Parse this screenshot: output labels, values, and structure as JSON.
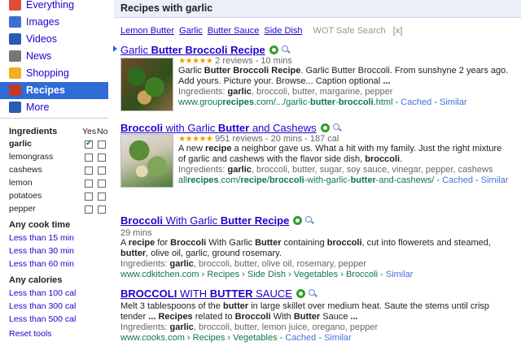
{
  "nav": {
    "items": [
      {
        "label": "Everything",
        "icon": "everything-icon",
        "color": "#e04b3a"
      },
      {
        "label": "Images",
        "icon": "images-icon",
        "color": "#3b6fd1"
      },
      {
        "label": "Videos",
        "icon": "videos-icon",
        "color": "#2a5bb5"
      },
      {
        "label": "News",
        "icon": "news-icon",
        "color": "#777777"
      },
      {
        "label": "Shopping",
        "icon": "shopping-icon",
        "color": "#f2b01e"
      },
      {
        "label": "Recipes",
        "icon": "recipes-icon",
        "color": "#c0392b",
        "selected": true
      },
      {
        "label": "More",
        "icon": "more-icon",
        "color": "#2a5bb5"
      }
    ]
  },
  "filters": {
    "ingredients_heading": "Ingredients",
    "yes_label": "Yes",
    "no_label": "No",
    "ingredients": [
      {
        "label": "garlic",
        "yes": true,
        "no": false,
        "strong": true
      },
      {
        "label": "lemongrass",
        "yes": false,
        "no": false
      },
      {
        "label": "cashews",
        "yes": false,
        "no": false
      },
      {
        "label": "lemon",
        "yes": false,
        "no": false
      },
      {
        "label": "potatoes",
        "yes": false,
        "no": false
      },
      {
        "label": "pepper",
        "yes": false,
        "no": false
      }
    ],
    "cook_time_heading": "Any cook time",
    "cook_times": [
      "Less than 15 min",
      "Less than 30 min",
      "Less than 60 min"
    ],
    "calories_heading": "Any calories",
    "calories": [
      "Less than 100 cal",
      "Less than 300 cal",
      "Less than 500 cal"
    ],
    "reset": "Reset tools"
  },
  "header": {
    "title": "Recipes with garlic"
  },
  "related": {
    "links": [
      "Lemon Butter",
      "Garlic",
      "Butter Sauce",
      "Side Dish"
    ],
    "wot": "WOT Safe Search",
    "close": "[x]"
  },
  "results": [
    {
      "title_parts": [
        [
          "Garlic ",
          false
        ],
        [
          "Butter Broccoli Recipe",
          true
        ]
      ],
      "stars": "★★★★★",
      "meta": "2 reviews - 10 mins",
      "snippet_html": "Garlic <b>Butter Broccoli Recipe</b>. Garlic Butter Broccoli. From sunshyne 2 years ago. Add yours. Picture your. Browse... Caption optional <b>...</b>",
      "ingredients_html": "Ingredients: <b>garlic</b>, broccoli, butter, margarine, pepper",
      "url_html": "www.group<b>recipes</b>.com/.../garlic-<b>butter</b>-<b>broccoli</b>.html",
      "cached": "Cached",
      "similar": "Similar"
    },
    {
      "title_parts": [
        [
          "Broccoli",
          true
        ],
        [
          " with Garlic ",
          false
        ],
        [
          "Butter",
          true
        ],
        [
          " and Cashews",
          false
        ]
      ],
      "stars": "★★★★★",
      "meta": "951 reviews - 20 mins - 187 cal",
      "snippet_html": "A new <b>recipe</b> a neighbor gave us. What a hit with my family. Just the right mixture of garlic and cashews with the flavor side dish, <b>broccoli</b>.",
      "ingredients_html": "Ingredients: <b>garlic</b>, broccoli, butter, sugar, soy sauce, vinegar, pepper, cashews",
      "url_html": "all<b>recipes</b>.com/<b>recipe</b>/<b>broccoli</b>-with-garlic-<b>butter</b>-and-cashews/",
      "cached": "Cached",
      "similar": "Similar"
    },
    {
      "title_parts": [
        [
          "Broccoli",
          true
        ],
        [
          " With Garlic ",
          false
        ],
        [
          "Butter Recipe",
          true
        ]
      ],
      "meta": "29 mins",
      "snippet_html": "A <b>recipe</b> for <b>Broccoli</b> With Garlic <b>Butter</b> containing <b>broccoli</b>, cut into flowerets and steamed, <b>butter</b>, olive oil, garlic, ground rosemary.",
      "ingredients_html": "Ingredients: <b>garlic</b>, broccoli, butter, olive oil, rosemary, pepper",
      "url_html": "www.cdkitchen.com › Recipes › Side Dish › Vegetables › Broccoli",
      "similar": "Similar"
    },
    {
      "title_parts": [
        [
          "BROCCOLI",
          true
        ],
        [
          " WITH ",
          false
        ],
        [
          "BUTTER",
          true
        ],
        [
          " SAUCE",
          false
        ]
      ],
      "snippet_html": "Melt 3 tablespoons of the <b>butter</b> in large skillet over medium heat. Saute the stems until crisp tender <b>...</b> <b>Recipes</b> related to <b>Broccoli</b> With <b>Butter</b> Sauce <b>...</b>",
      "ingredients_html": "Ingredients: <b>garlic</b>, broccoli, butter, lemon juice, oregano, pepper",
      "url_html": "www.cooks.com › Recipes › Vegetables",
      "cached": "Cached",
      "similar": "Similar"
    }
  ]
}
